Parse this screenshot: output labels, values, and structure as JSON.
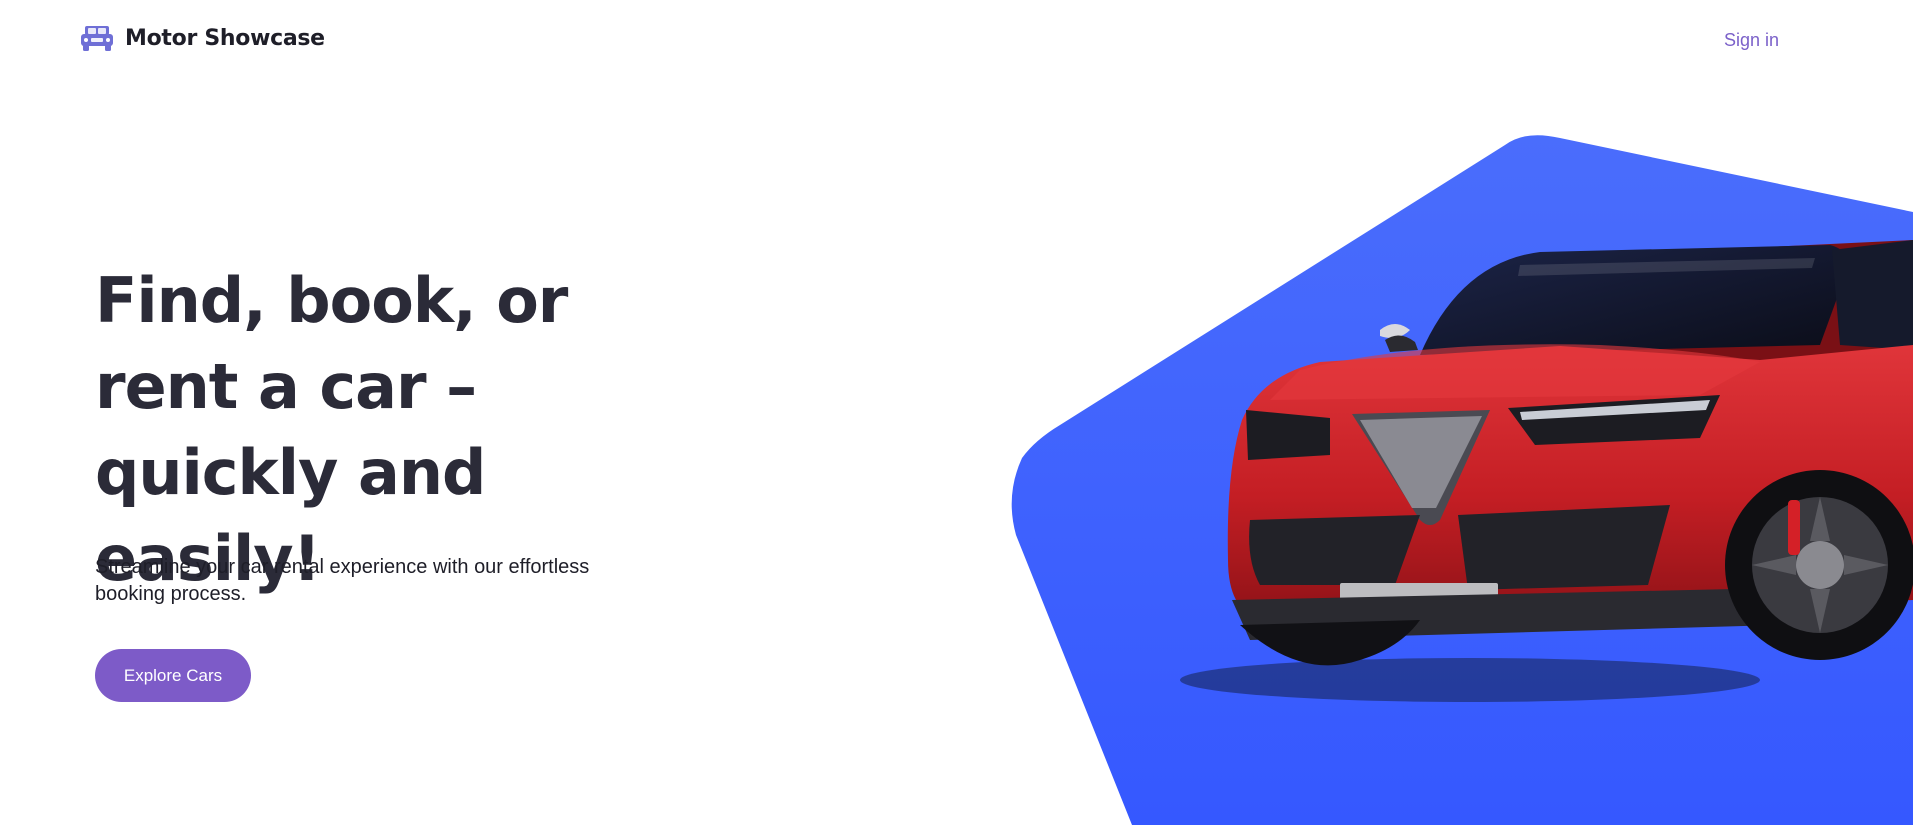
{
  "header": {
    "brand_name": "Motor Showcase",
    "brand_icon": "jeep-car-icon",
    "sign_in_label": "Sign in"
  },
  "hero": {
    "title": "Find, book, or rent a car – quickly and easily!",
    "subtitle": "Streamline your car rental experience with our effortless booking process.",
    "cta_label": "Explore Cars"
  },
  "theme": {
    "accent": "#7d5bc8",
    "link": "#7b61c9",
    "hero_shape": "#3d64ff",
    "car_body": "#c81f25",
    "text_dark": "#2b2b38"
  }
}
